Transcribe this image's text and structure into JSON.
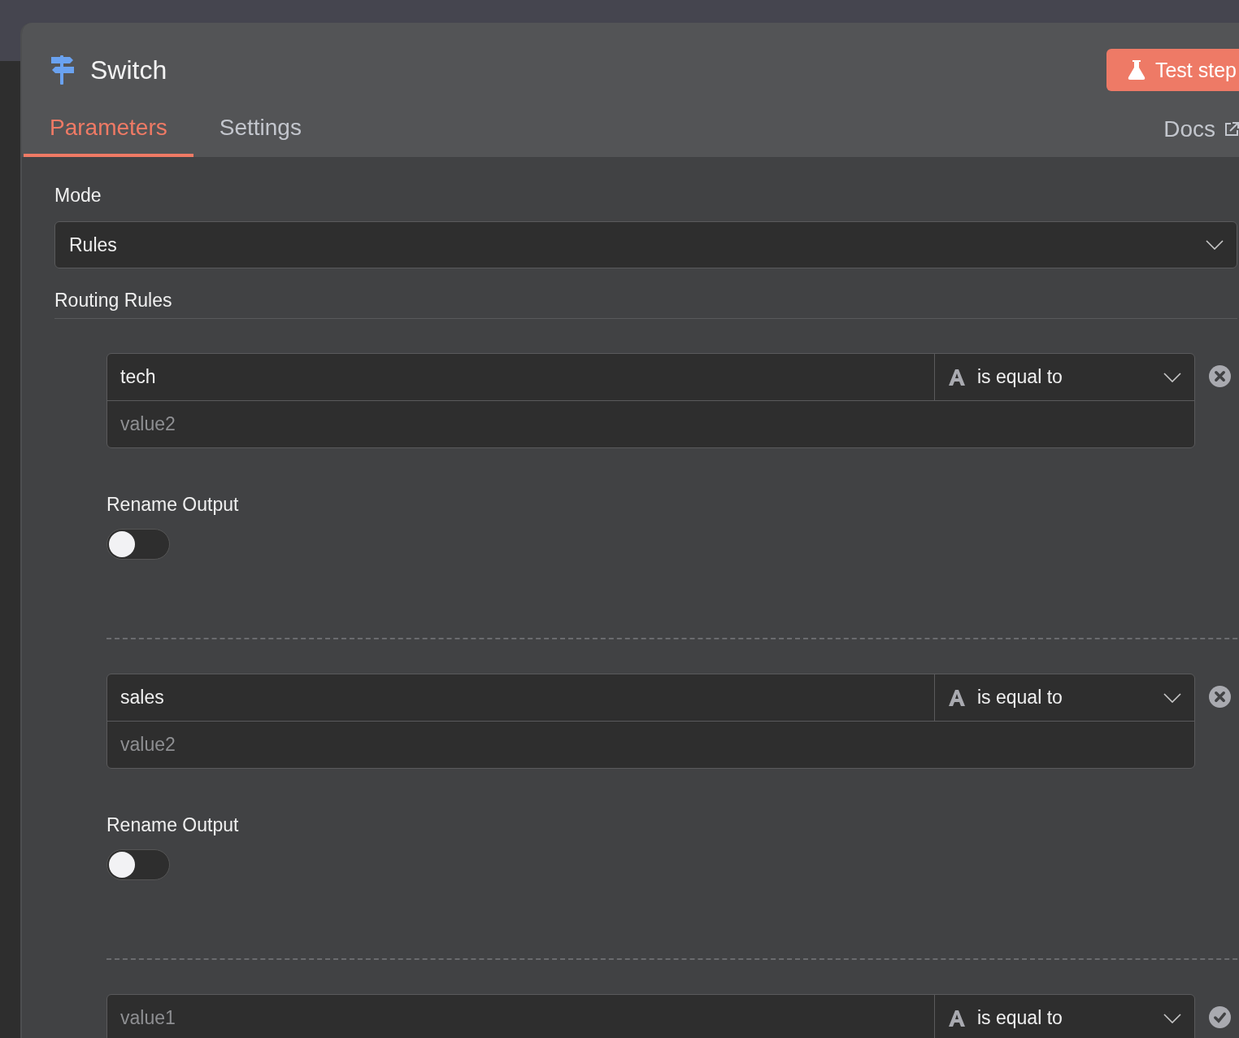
{
  "node": {
    "title": "Switch",
    "test_button": "Test step"
  },
  "tabs": [
    {
      "label": "Parameters",
      "selected": true
    },
    {
      "label": "Settings",
      "selected": false
    }
  ],
  "docs_link": "Docs",
  "mode": {
    "label": "Mode",
    "value": "Rules"
  },
  "routing_rules": {
    "label": "Routing Rules",
    "rules": [
      {
        "kind": "remove",
        "left": {
          "value": "tech"
        },
        "operator": "is equal to",
        "right": {
          "placeholder": "value2"
        },
        "rename_output": {
          "label": "Rename Output",
          "on": false
        }
      },
      {
        "kind": "remove",
        "left": {
          "value": "sales"
        },
        "operator": "is equal to",
        "right": {
          "placeholder": "value2"
        },
        "rename_output": {
          "label": "Rename Output",
          "on": false
        }
      },
      {
        "kind": "confirm",
        "left": {
          "placeholder": "value1"
        },
        "operator": "is equal to"
      }
    ]
  }
}
